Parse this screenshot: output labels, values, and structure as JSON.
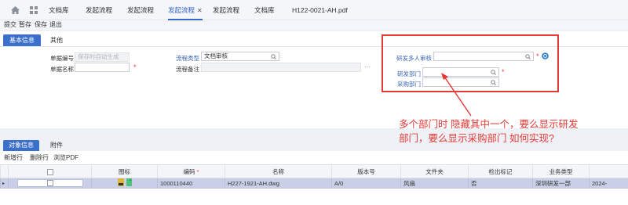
{
  "tabs": [
    {
      "label": "文档库",
      "active": false
    },
    {
      "label": "发起流程",
      "active": false
    },
    {
      "label": "发起流程",
      "active": false
    },
    {
      "label": "发起流程",
      "active": true
    },
    {
      "label": "发起流程",
      "active": false
    },
    {
      "label": "文档库",
      "active": false
    },
    {
      "label": "H122-0021-AH.pdf",
      "active": false
    }
  ],
  "close_glyph": "✕",
  "toolbar": {
    "submit": "提交",
    "stash": "暂存",
    "save": "保存",
    "exit": "退出"
  },
  "form_tabs": {
    "basic": "基本信息",
    "other": "其他"
  },
  "form": {
    "doc_no_label": "单据编号",
    "doc_no_placeholder": "保存时自动生成",
    "doc_name_label": "单据名称",
    "doc_name_value": "",
    "flow_type_label": "流程类型",
    "flow_type_value": "文档审核",
    "flow_note_label": "流程备注",
    "flow_note_value": "",
    "dots": "···",
    "multi_reviewer_label": "研发多人审核",
    "rd_dept_label": "研发部门",
    "purchase_dept_label": "采购部门",
    "required_mark": "*"
  },
  "annotation": {
    "line1": "多个部门时 隐藏其中一个，要么显示研发",
    "line2": "部门，要么显示采购部门 如何实现?"
  },
  "lower_tabs": {
    "object": "对象信息",
    "attach": "附件"
  },
  "lower_toolbar": {
    "add": "新增行",
    "delete": "删除行",
    "browse": "浏览PDF"
  },
  "table": {
    "headers": [
      "",
      "图标",
      "编码",
      "名称",
      "版本号",
      "文件夹",
      "检出标记",
      "业务类型",
      ""
    ],
    "required_mark": "*",
    "rows": [
      [
        "",
        "",
        "1000110440",
        "H227-1921-AH.dwg",
        "A/0",
        "风扇",
        "否",
        "深圳研发一部",
        "2024-"
      ]
    ]
  },
  "colors": {
    "accent": "#3b6fc9",
    "annotation": "#e53935",
    "selected_row": "#c8cfe6"
  }
}
